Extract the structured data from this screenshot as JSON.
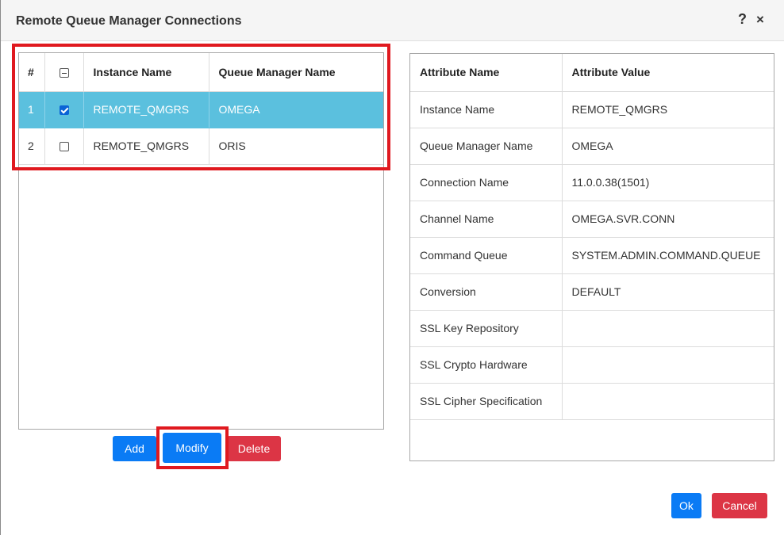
{
  "dialog": {
    "title": "Remote Queue Manager Connections",
    "help_label": "?",
    "close_label": "×"
  },
  "connections_table": {
    "columns": [
      "#",
      "",
      "Instance Name",
      "Queue Manager Name"
    ],
    "rows": [
      {
        "num": "1",
        "checked": true,
        "instance": "REMOTE_QMGRS",
        "qmgr": "OMEGA",
        "selected": true
      },
      {
        "num": "2",
        "checked": false,
        "instance": "REMOTE_QMGRS",
        "qmgr": "ORIS",
        "selected": false
      }
    ]
  },
  "attributes_table": {
    "columns": [
      "Attribute Name",
      "Attribute Value"
    ],
    "rows": [
      {
        "name": "Instance Name",
        "value": "REMOTE_QMGRS"
      },
      {
        "name": "Queue Manager Name",
        "value": "OMEGA"
      },
      {
        "name": "Connection Name",
        "value": "11.0.0.38(1501)"
      },
      {
        "name": "Channel Name",
        "value": "OMEGA.SVR.CONN"
      },
      {
        "name": "Command Queue",
        "value": "SYSTEM.ADMIN.COMMAND.QUEUE"
      },
      {
        "name": "Conversion",
        "value": "DEFAULT"
      },
      {
        "name": "SSL Key Repository",
        "value": ""
      },
      {
        "name": "SSL Crypto Hardware",
        "value": ""
      },
      {
        "name": "SSL Cipher Specification",
        "value": ""
      }
    ]
  },
  "actions": {
    "add_label": "Add",
    "modify_label": "Modify",
    "delete_label": "Delete",
    "ok_label": "Ok",
    "cancel_label": "Cancel"
  },
  "colors": {
    "primary": "#0a7bf5",
    "danger": "#dc3545",
    "selected_row": "#5bc0de",
    "highlight": "#e0191f"
  }
}
